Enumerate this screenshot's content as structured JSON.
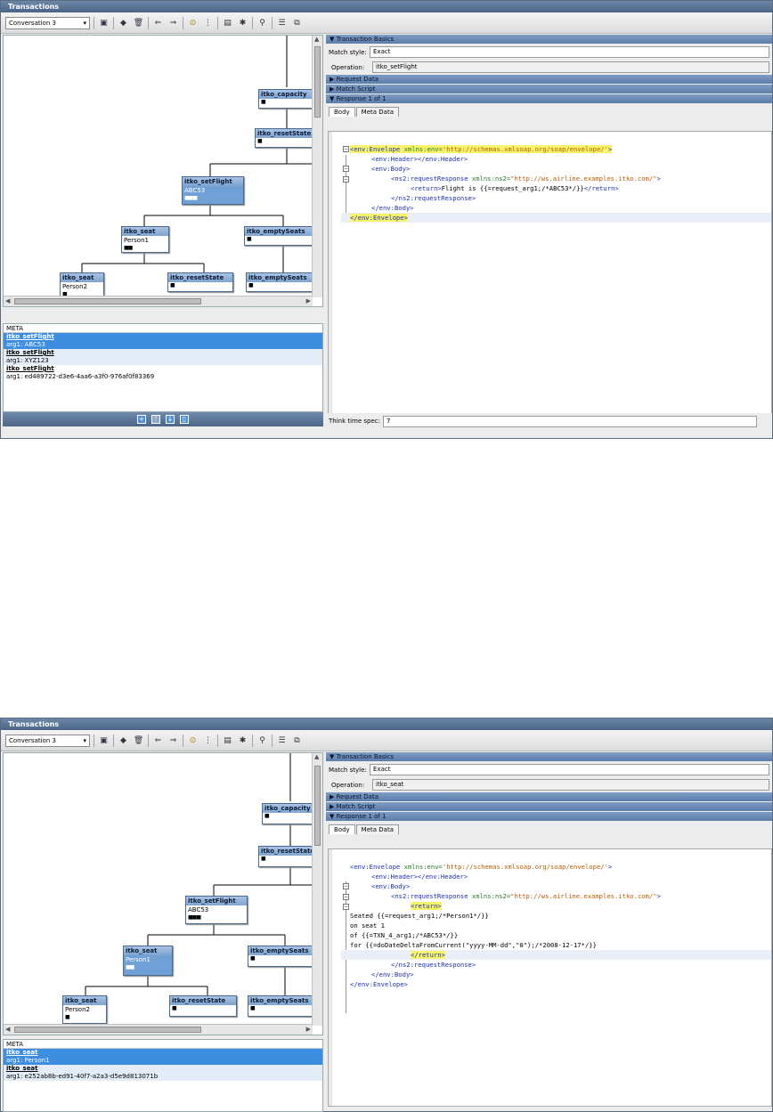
{
  "screens": [
    {
      "title": "Transactions",
      "conversation": "Conversation 3",
      "nodes": {
        "capacity": "itko_capacity",
        "resetState_top": "itko_resetState",
        "setFlight": {
          "title": "itko_setFlight",
          "body": "ABC53"
        },
        "seat1": {
          "title": "itko_seat",
          "body": "Person1"
        },
        "emptySeats1": "itko_emptySeats",
        "seat2": {
          "title": "itko_seat",
          "body": "Person2"
        },
        "resetState2": "itko_resetState",
        "emptySeats2": "itko_emptySeats"
      },
      "meta_header": "META",
      "meta_rows": [
        {
          "title": "itko_setFlight",
          "arg": "arg1: ABC53"
        },
        {
          "title": "itko_setFlight",
          "arg": "arg1: XYZ123"
        },
        {
          "title": "itko_setFlight",
          "arg": "arg1: ed489722-d3e6-4aa6-a3f0-976af0f83369"
        }
      ],
      "sections": {
        "basics": "Transaction Basics",
        "request": "Request Data",
        "script": "Match Script",
        "response": "Response 1 of 1"
      },
      "match_style_label": "Match style:",
      "match_style_value": "Exact",
      "operation_label": "Operation:",
      "operation_value": "itko_setFlight",
      "tabs": [
        "Body",
        "Meta Data"
      ],
      "code": [
        "<env:Envelope xmlns:env='http://schemas.xmlsoap.org/soap/envelope/'>",
        "<env:Header></env:Header>",
        "<env:Body>",
        "<ns2:requestResponse xmlns:ns2=\"http://ws.airline.examples.itko.com/\">",
        "<return>Flight is {{=request_arg1;/*ABC53*/}}</return>",
        "</ns2:requestResponse>",
        "</env:Body>",
        "</env:Envelope>"
      ],
      "think_label": "Think time spec:",
      "think_value": "7"
    },
    {
      "title": "Transactions",
      "conversation": "Conversation 3",
      "nodes": {
        "capacity": "itko_capacity",
        "resetState_top": "itko_resetState",
        "setFlight": {
          "title": "itko_setFlight",
          "body": "ABC53"
        },
        "seat1": {
          "title": "itko_seat",
          "body": "Person1"
        },
        "emptySeats1": "itko_emptySeats",
        "seat2": {
          "title": "itko_seat",
          "body": "Person2"
        },
        "resetState2": "itko_resetState",
        "emptySeats2": "itko_emptySeats"
      },
      "meta_header": "META",
      "meta_rows": [
        {
          "title": "itko_seat",
          "arg": "arg1: Person1"
        },
        {
          "title": "itko_seat",
          "arg": "arg1: e252ab8b-ed91-40f7-a2a3-d5e9d813071b"
        }
      ],
      "sections": {
        "basics": "Transaction Basics",
        "request": "Request Data",
        "script": "Match Script",
        "response": "Response 1 of 1"
      },
      "match_style_label": "Match style:",
      "match_style_value": "Exact",
      "operation_label": "Operation:",
      "operation_value": "itko_seat",
      "tabs": [
        "Body",
        "Meta Data"
      ],
      "code": [
        "<env:Envelope xmlns:env='http://schemas.xmlsoap.org/soap/envelope/'>",
        "<env:Header></env:Header>",
        "<env:Body>",
        "<ns2:requestResponse xmlns:ns2=\"http://ws.airline.examples.itko.com/\">",
        "<return>",
        "Seated {{=request_arg1;/*Person1*/}}",
        "on seat 1",
        "of {{=TXN_4_arg1;/*ABC53*/}}",
        "for {{=doDateDeltaFromCurrent(\"yyyy-MM-dd\",\"0\");/*2008-12-17*/}}",
        "</return>",
        "</ns2:requestResponse>",
        "</env:Body>",
        "</env:Envelope>"
      ]
    }
  ]
}
